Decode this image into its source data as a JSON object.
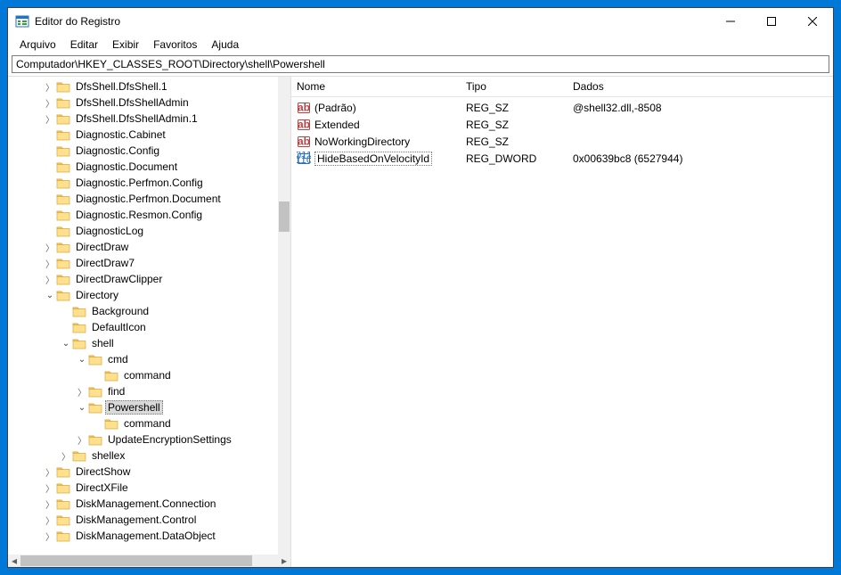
{
  "window": {
    "title": "Editor do Registro"
  },
  "menu": {
    "items": [
      "Arquivo",
      "Editar",
      "Exibir",
      "Favoritos",
      "Ajuda"
    ]
  },
  "address": "Computador\\HKEY_CLASSES_ROOT\\Directory\\shell\\Powershell",
  "tree": [
    {
      "d": 2,
      "exp": "closed",
      "label": "DfsShell.DfsShell.1"
    },
    {
      "d": 2,
      "exp": "closed",
      "label": "DfsShell.DfsShellAdmin"
    },
    {
      "d": 2,
      "exp": "closed",
      "label": "DfsShell.DfsShellAdmin.1"
    },
    {
      "d": 2,
      "exp": "none",
      "label": "Diagnostic.Cabinet"
    },
    {
      "d": 2,
      "exp": "none",
      "label": "Diagnostic.Config"
    },
    {
      "d": 2,
      "exp": "none",
      "label": "Diagnostic.Document"
    },
    {
      "d": 2,
      "exp": "none",
      "label": "Diagnostic.Perfmon.Config"
    },
    {
      "d": 2,
      "exp": "none",
      "label": "Diagnostic.Perfmon.Document"
    },
    {
      "d": 2,
      "exp": "none",
      "label": "Diagnostic.Resmon.Config"
    },
    {
      "d": 2,
      "exp": "none",
      "label": "DiagnosticLog"
    },
    {
      "d": 2,
      "exp": "closed",
      "label": "DirectDraw"
    },
    {
      "d": 2,
      "exp": "closed",
      "label": "DirectDraw7"
    },
    {
      "d": 2,
      "exp": "closed",
      "label": "DirectDrawClipper"
    },
    {
      "d": 2,
      "exp": "open",
      "label": "Directory"
    },
    {
      "d": 3,
      "exp": "none",
      "label": "Background"
    },
    {
      "d": 3,
      "exp": "none",
      "label": "DefaultIcon"
    },
    {
      "d": 3,
      "exp": "open",
      "label": "shell"
    },
    {
      "d": 4,
      "exp": "open",
      "label": "cmd"
    },
    {
      "d": 5,
      "exp": "none",
      "label": "command"
    },
    {
      "d": 4,
      "exp": "closed",
      "label": "find"
    },
    {
      "d": 4,
      "exp": "open",
      "label": "Powershell",
      "selected": true
    },
    {
      "d": 5,
      "exp": "none",
      "label": "command"
    },
    {
      "d": 4,
      "exp": "closed",
      "label": "UpdateEncryptionSettings"
    },
    {
      "d": 3,
      "exp": "closed",
      "label": "shellex"
    },
    {
      "d": 2,
      "exp": "closed",
      "label": "DirectShow"
    },
    {
      "d": 2,
      "exp": "closed",
      "label": "DirectXFile"
    },
    {
      "d": 2,
      "exp": "closed",
      "label": "DiskManagement.Connection"
    },
    {
      "d": 2,
      "exp": "closed",
      "label": "DiskManagement.Control"
    },
    {
      "d": 2,
      "exp": "closed",
      "label": "DiskManagement.DataObject"
    }
  ],
  "columns": {
    "name": "Nome",
    "type": "Tipo",
    "data": "Dados"
  },
  "values": [
    {
      "icon": "string",
      "name": "(Padrão)",
      "type": "REG_SZ",
      "data": "@shell32.dll,-8508"
    },
    {
      "icon": "string",
      "name": "Extended",
      "type": "REG_SZ",
      "data": ""
    },
    {
      "icon": "string",
      "name": "NoWorkingDirectory",
      "type": "REG_SZ",
      "data": ""
    },
    {
      "icon": "binary",
      "name": "HideBasedOnVelocityId",
      "type": "REG_DWORD",
      "data": "0x00639bc8 (6527944)",
      "selected": true
    }
  ]
}
